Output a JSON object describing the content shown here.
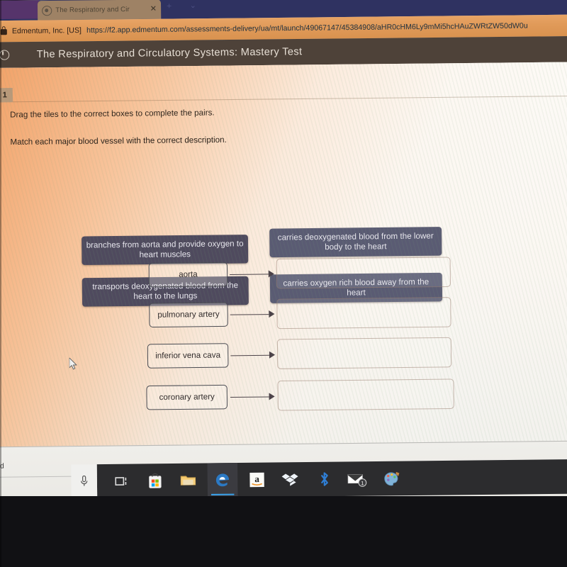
{
  "browser": {
    "tab": {
      "title": "The Respiratory and Cir",
      "close_label": "✕",
      "favicon_name": "edge-favicon"
    },
    "new_tab_label": "+",
    "tab_list_chevron": "⌄",
    "address_bar": {
      "security_label": "Edmentum, Inc. [US]",
      "url": "https://f2.app.edmentum.com/assessments-delivery/ua/mt/launch/49067147/45384908/aHR0cHM6Ly9mMi5hcHAuZWRtZW50dW0u",
      "lock_icon": "lock-icon"
    }
  },
  "app_header": {
    "title": "The Respiratory and Circulatory Systems: Mastery Test",
    "icon": "timer-clock-icon"
  },
  "question": {
    "number": "1",
    "instruction_1": "Drag the tiles to the correct boxes to complete the pairs.",
    "instruction_2": "Match each major blood vessel with the correct description."
  },
  "tiles": [
    {
      "id": "tile-branches-from-aorta",
      "text": "branches from aorta and provide oxygen to heart muscles",
      "color": "#4f4a5e"
    },
    {
      "id": "tile-transports-deoxygenated",
      "text": "transports deoxygenated blood from the heart to the lungs",
      "color": "#4f4a5e"
    },
    {
      "id": "tile-carries-deoxygenated",
      "text": "carries deoxygenated blood from the lower body to the heart",
      "color": "#5a5b73"
    },
    {
      "id": "tile-carries-oxygen-rich",
      "text": "carries oxygen rich blood away from the heart",
      "color": "#5a5b73"
    }
  ],
  "match_rows": [
    {
      "label": "aorta",
      "drop_value": ""
    },
    {
      "label": "pulmonary artery",
      "drop_value": ""
    },
    {
      "label": "inferior vena cava",
      "drop_value": ""
    },
    {
      "label": "coronary artery",
      "drop_value": ""
    }
  ],
  "status_bar": {
    "text_fragment": "d"
  },
  "taskbar": {
    "items": [
      {
        "name": "cortana-microphone-icon",
        "label": ""
      },
      {
        "name": "task-view-icon",
        "label": ""
      },
      {
        "name": "microsoft-store-icon",
        "label": ""
      },
      {
        "name": "file-explorer-icon",
        "label": ""
      },
      {
        "name": "microsoft-edge-icon",
        "label": "",
        "active": true
      },
      {
        "name": "amazon-icon",
        "label": "a"
      },
      {
        "name": "dropbox-icon",
        "label": ""
      },
      {
        "name": "bluetooth-icon",
        "label": ""
      },
      {
        "name": "mail-icon",
        "label": "",
        "badge": "1"
      },
      {
        "name": "paint-3d-icon",
        "label": ""
      }
    ]
  },
  "colors": {
    "tab_strip": "#2f3261",
    "url_bar": "#e09a59",
    "app_header": "#4e4239",
    "tile_left": "#4f4a5e",
    "tile_right": "#5a5b73",
    "taskbar": "#2c2c2e",
    "edge_accent": "#3aa0e8"
  }
}
